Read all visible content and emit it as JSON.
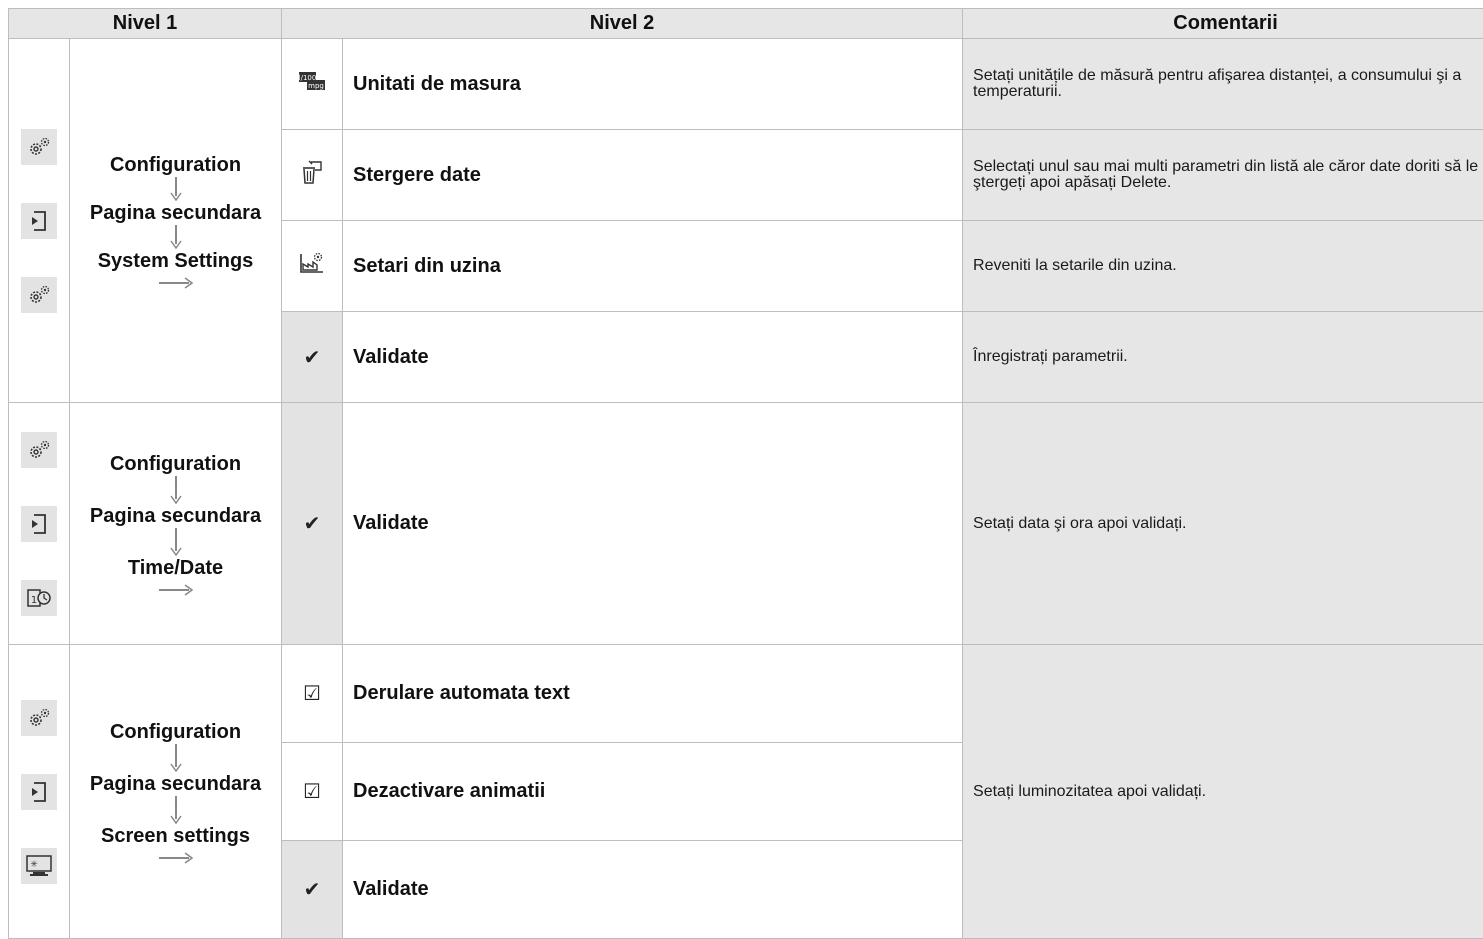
{
  "headers": {
    "nivel1": "Nivel 1",
    "nivel2": "Nivel 2",
    "comentarii": "Comentarii"
  },
  "sections": [
    {
      "icons": [
        "gears-icon",
        "page-next-icon",
        "gears-icon"
      ],
      "flow": [
        "Configuration",
        "Pagina secundara",
        "System Settings"
      ],
      "items": [
        {
          "icon": "units-mpg-icon",
          "label": "Unitati de masura"
        },
        {
          "icon": "delete-data-icon",
          "label": "Stergere date"
        },
        {
          "icon": "factory-settings-icon",
          "label": "Setari din uzina"
        },
        {
          "icon": "check-icon",
          "icon_glyph": "✔",
          "label": "Validate"
        }
      ],
      "comments": [
        "Setați unitățile de măsură pentru afişarea distanței, a consumului şi a temperaturii.",
        "Selectați unul sau mai multi parametri din listă ale căror date doriti să le ştergeți apoi apăsați Delete.",
        "Reveniti la setarile din uzina.",
        "Înregistrați parametrii."
      ]
    },
    {
      "icons": [
        "gears-icon",
        "page-next-icon",
        "calendar-clock-icon"
      ],
      "flow": [
        "Configuration",
        "Pagina secundara",
        "Time/Date"
      ],
      "items": [
        {
          "icon": "check-icon",
          "icon_glyph": "✔",
          "label": "Validate"
        }
      ],
      "comment": "Setați data şi ora apoi validați."
    },
    {
      "icons": [
        "gears-icon",
        "page-next-icon",
        "screen-brightness-icon"
      ],
      "flow": [
        "Configuration",
        "Pagina secundara",
        "Screen settings"
      ],
      "items": [
        {
          "icon": "checkbox-icon",
          "icon_glyph": "☑",
          "label": "Derulare automata text"
        },
        {
          "icon": "checkbox-icon",
          "icon_glyph": "☑",
          "label": "Dezactivare animatii"
        },
        {
          "icon": "check-icon",
          "icon_glyph": "✔",
          "label": "Validate"
        }
      ],
      "comment": "Setați luminozitatea apoi validați."
    }
  ]
}
